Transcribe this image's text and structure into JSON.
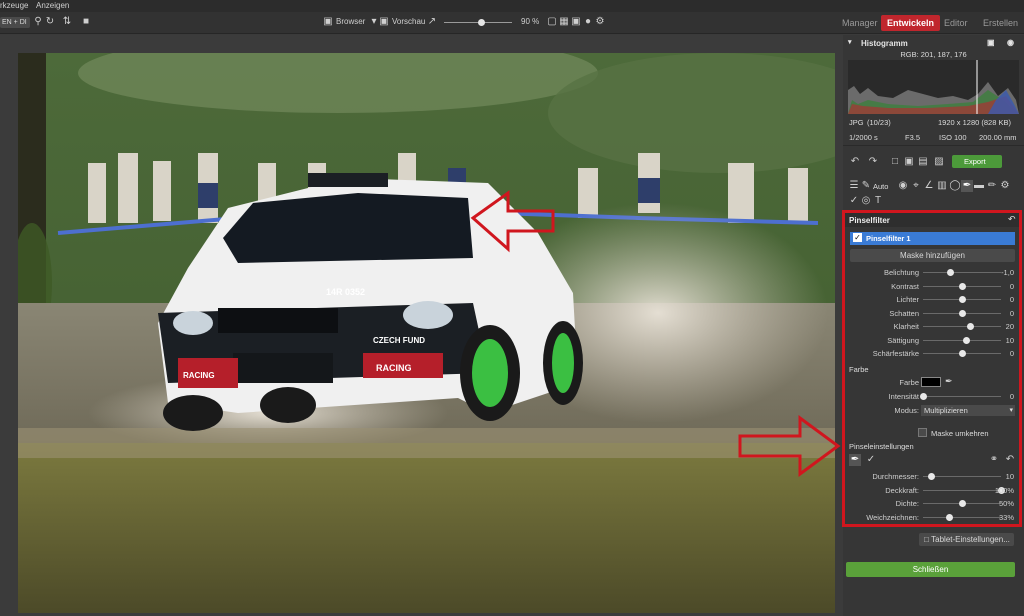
{
  "menubar": {
    "item_1": "rkzeuge",
    "item_2": "Anzeigen"
  },
  "toolbar": {
    "left_field": "EN + DI",
    "browser_label": "Browser",
    "preview_label": "Vorschau",
    "zoom_value": "90 %",
    "zoom_level": 0.55
  },
  "modes": {
    "manager": "Manager",
    "develop": "Entwickeln",
    "editor": "Editor",
    "create": "Erstellen"
  },
  "histogram": {
    "title": "Histogramm",
    "rgb": "RGB: 201, 187, 176",
    "format": "JPG",
    "index": "(10/23)",
    "dimensions": "1920 x 1280 (828 KB)",
    "shutter": "1/2000 s",
    "aperture": "F3.5",
    "iso": "ISO 100",
    "focal": "200.00 mm"
  },
  "actions": {
    "export": "Export",
    "auto": "Auto"
  },
  "brush_panel": {
    "title": "Pinselfilter",
    "filter_name": "Pinselfilter 1",
    "add_mask": "Maske hinzufügen",
    "sliders": [
      {
        "label": "Belichtung",
        "value": "-1,0",
        "pos": 0.35
      },
      {
        "label": "Kontrast",
        "value": "0",
        "pos": 0.5
      },
      {
        "label": "Lichter",
        "value": "0",
        "pos": 0.5
      },
      {
        "label": "Schatten",
        "value": "0",
        "pos": 0.5
      },
      {
        "label": "Klarheit",
        "value": "20",
        "pos": 0.6
      },
      {
        "label": "Sättigung",
        "value": "10",
        "pos": 0.55
      },
      {
        "label": "Schärfestärke",
        "value": "0",
        "pos": 0.5
      }
    ],
    "color_section": "Farbe",
    "color_label": "Farbe",
    "color_value": "#000000",
    "intensity_label": "Intensität",
    "intensity_value": "0",
    "intensity_pos": 0.0,
    "mode_label": "Modus:",
    "mode_value": "Multiplizieren",
    "invert_mask": "Maske umkehren",
    "brush_settings": "Pinseleinstellungen",
    "brush_sliders": [
      {
        "label": "Durchmesser:",
        "value": "10",
        "pos": 0.1
      },
      {
        "label": "Deckkraft:",
        "value": "100%",
        "pos": 1.0
      },
      {
        "label": "Dichte:",
        "value": "50%",
        "pos": 0.5
      },
      {
        "label": "Weichzeichnen:",
        "value": "33%",
        "pos": 0.33
      }
    ],
    "tablet_settings": "Tablet-Einstellungen...",
    "close": "Schließen"
  },
  "photo": {
    "plate": "14R 0352",
    "sponsor_1": "CZECH FUND",
    "sponsor_2": "RACING",
    "sponsor_3": "RACING"
  },
  "colors": {
    "accent": "#c0262d",
    "close_btn": "#5aa13a",
    "highlight": "#3a7bd5",
    "annotation": "#d0161e"
  }
}
